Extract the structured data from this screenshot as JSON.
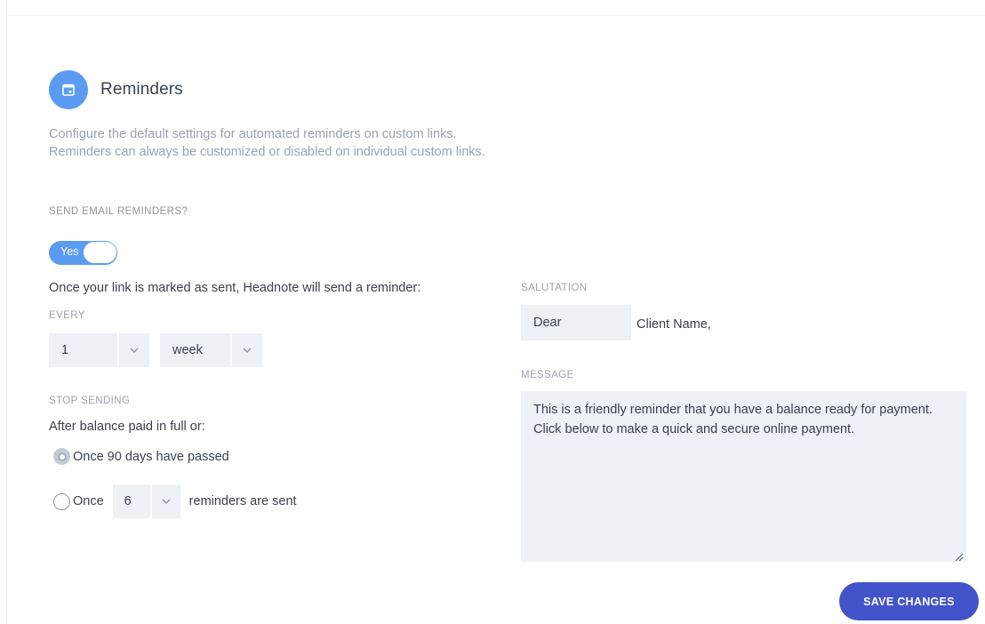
{
  "header": {
    "title": "Reminders",
    "icon": "calendar-icon"
  },
  "description": "Configure the default settings for automated reminders on custom links. Reminders can always be customized or disabled on individual custom links.",
  "send_email": {
    "label": "SEND EMAIL REMINDERS?",
    "toggle_label": "Yes",
    "enabled": true
  },
  "schedule": {
    "intro": "Once your link is marked as sent, Headnote will send a reminder:",
    "every_label": "EVERY",
    "every_value": "1",
    "unit_value": "week"
  },
  "stop": {
    "label": "STOP SENDING",
    "intro": "After balance paid in full or:",
    "option_days": "Once 90 days have passed",
    "option_count_prefix": "Once",
    "count_value": "6",
    "option_count_suffix": "reminders are sent",
    "selected": "days"
  },
  "salutation": {
    "label": "SALUTATION",
    "value": "Dear",
    "name_text": "Client Name,"
  },
  "message": {
    "label": "MESSAGE",
    "value": "This is a friendly reminder that you have a balance ready for payment. Click below to make a quick and secure online payment."
  },
  "actions": {
    "save_label": "SAVE CHANGES"
  },
  "colors": {
    "accent_blue": "#5b9cf2",
    "button_indigo": "#4353c9",
    "muted_text": "#9aa3b3",
    "field_bg": "#eef1f5"
  }
}
